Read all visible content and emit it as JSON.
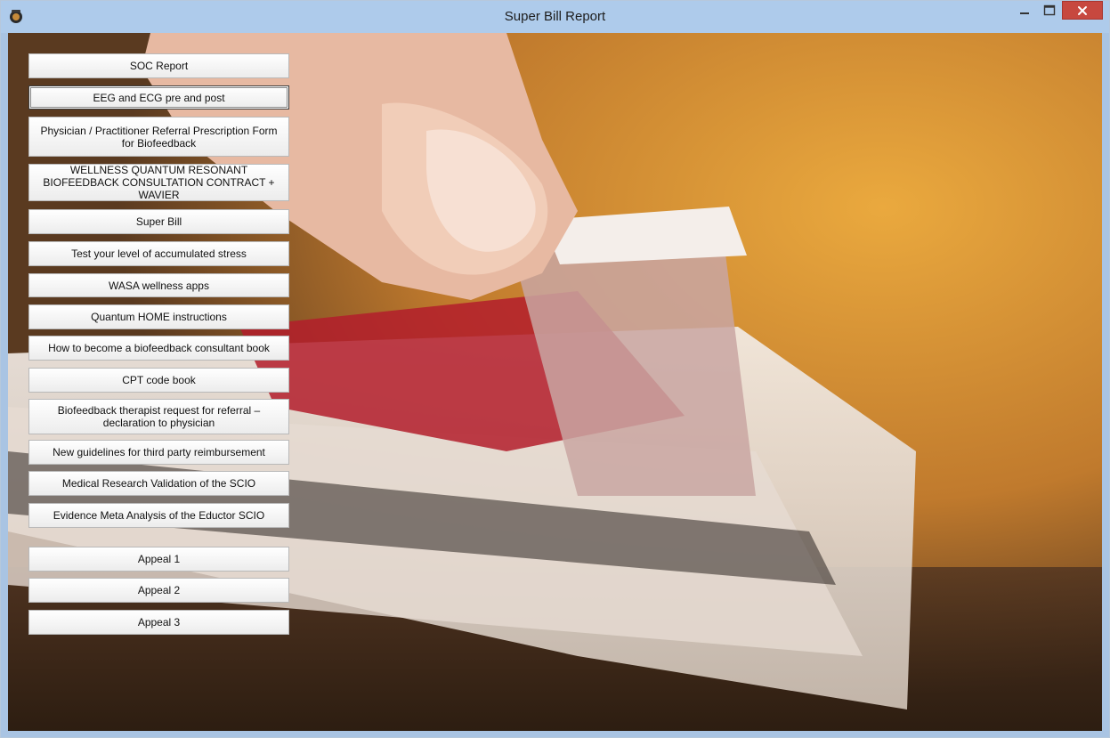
{
  "window": {
    "title": "Super Bill Report",
    "controls": [
      "minimize-icon",
      "maximize-icon",
      "close-icon"
    ]
  },
  "colors": {
    "titlebar": "#aecbeb",
    "close_button": "#c7483f",
    "button_face": "#f2f2f2"
  },
  "menu": {
    "items": [
      {
        "label": "SOC Report"
      },
      {
        "label": "EEG and ECG pre and post"
      },
      {
        "label": "Physician / Practitioner Referral Prescription Form for Biofeedback"
      },
      {
        "label": "WELLNESS QUANTUM RESONANT BIOFEEDBACK CONSULTATION CONTRACT + WAVIER"
      },
      {
        "label": "Super Bill"
      },
      {
        "label": "Test your level of accumulated stress"
      },
      {
        "label": "WASA wellness apps"
      },
      {
        "label": "Quantum HOME instructions"
      },
      {
        "label": "How to become a biofeedback consultant book"
      },
      {
        "label": "CPT code book"
      },
      {
        "label": "Biofeedback therapist request for referral – declaration to physician"
      },
      {
        "label": "New guidelines for third party reimbursement"
      },
      {
        "label": "Medical Research Validation of the SCIO"
      },
      {
        "label": "Evidence Meta Analysis of the Eductor SCIO"
      },
      {
        "label": "Appeal 1"
      },
      {
        "label": "Appeal 2"
      },
      {
        "label": "Appeal 3"
      }
    ]
  }
}
